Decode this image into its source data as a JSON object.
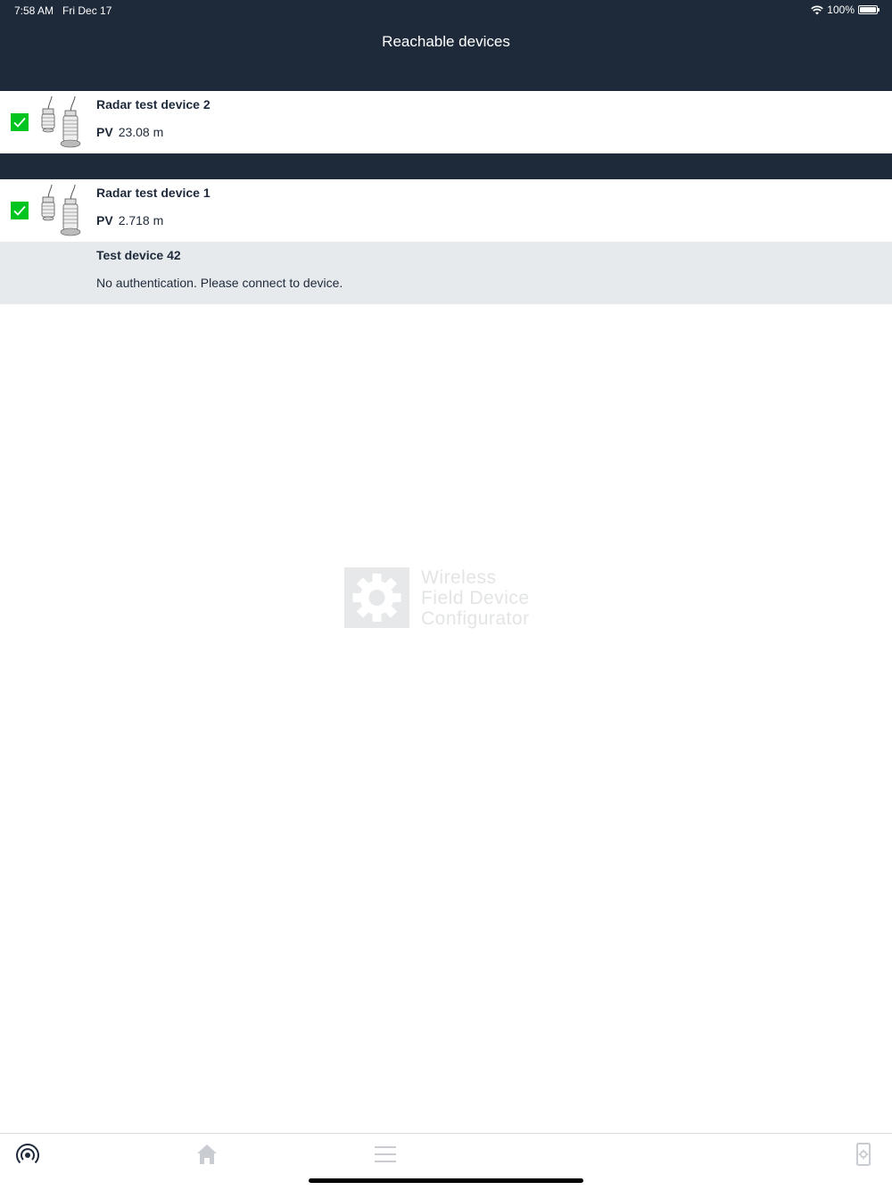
{
  "status_bar": {
    "time": "7:58 AM",
    "date": "Fri Dec 17",
    "battery": "100%"
  },
  "header": {
    "title": "Reachable devices"
  },
  "devices": [
    {
      "name": "Radar test device 2",
      "pv_label": "PV",
      "pv_value": "23.08 m",
      "checked": true
    },
    {
      "name": "Radar test device 1",
      "pv_label": "PV",
      "pv_value": "2.718 m",
      "checked": true
    },
    {
      "name": "Test device 42",
      "message": "No authentication. Please connect to device."
    }
  ],
  "watermark": {
    "line1": "Wireless",
    "line2": "Field Device",
    "line3": "Configurator"
  },
  "tabs": [
    {
      "icon": "radar-scan-icon",
      "active": true
    },
    {
      "icon": "home-icon",
      "active": false
    },
    {
      "icon": "menu-icon",
      "active": false
    },
    {
      "icon": "device-settings-icon",
      "active": false
    }
  ],
  "colors": {
    "header_bg": "#1e2a3a",
    "check_green": "#00c41f",
    "disabled_row_bg": "#e7eaed",
    "inactive_icon": "#c9cdd2"
  }
}
